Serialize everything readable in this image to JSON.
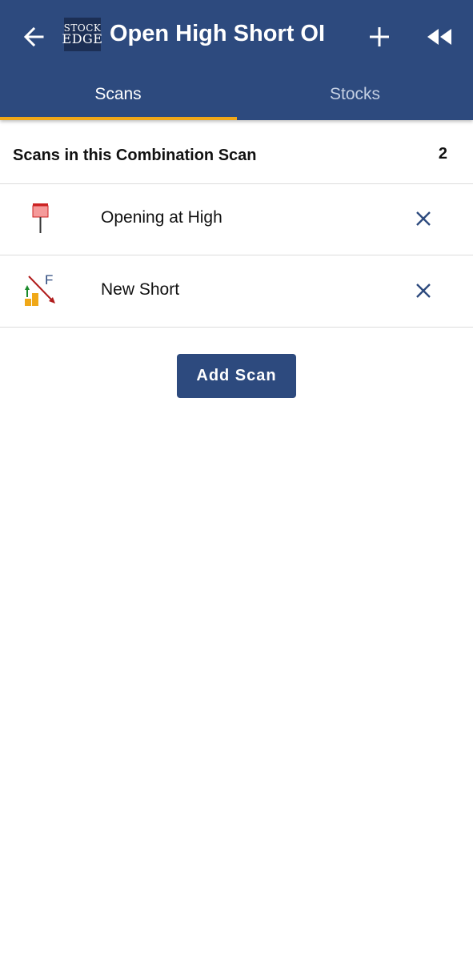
{
  "appbar": {
    "title": "Open High Short OI",
    "logo": {
      "line1": "STOCK",
      "line2": "EDGE"
    },
    "icons": {
      "back": "arrow-left-icon",
      "add": "plus-icon",
      "rewind": "rewind-icon"
    }
  },
  "tabs": [
    {
      "label": "Scans",
      "selected": true
    },
    {
      "label": "Stocks",
      "selected": false
    }
  ],
  "section": {
    "title": "Scans in this Combination Scan",
    "count": "2"
  },
  "scans": [
    {
      "label": "Opening at High",
      "icon": "candle-open-high-icon"
    },
    {
      "label": "New Short",
      "icon": "new-short-futures-icon",
      "icon_text": "F"
    }
  ],
  "add_button": {
    "label": "Add Scan"
  },
  "colors": {
    "primary": "#2d4a7e",
    "tab_indicator": "#f0a818",
    "divider": "#dcdcdc"
  }
}
